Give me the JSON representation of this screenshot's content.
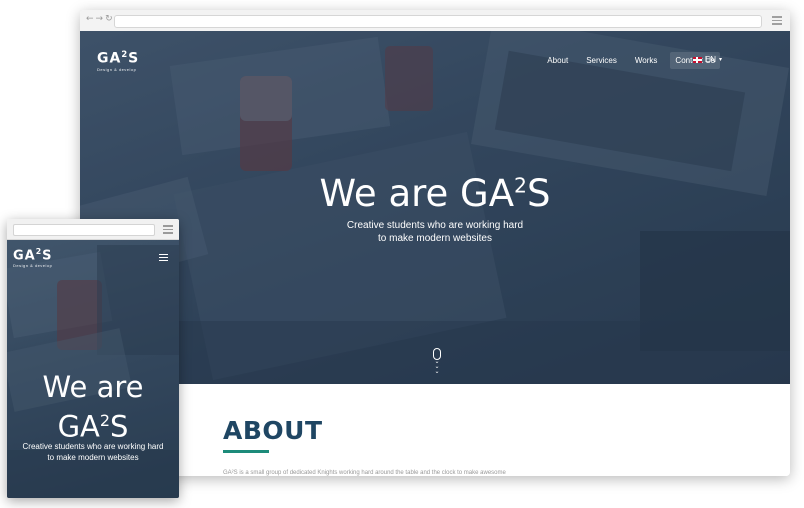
{
  "desktop": {
    "brand": {
      "name": "GA",
      "sup": "2",
      "suffix": "S",
      "tagline": "Design & develop"
    },
    "nav": [
      {
        "label": "About"
      },
      {
        "label": "Services"
      },
      {
        "label": "Works"
      },
      {
        "label": "Contact Us",
        "active": true
      }
    ],
    "language": {
      "code": "EN",
      "caret": "▾"
    },
    "hero": {
      "title_prefix": "We are GA",
      "title_sup": "2",
      "title_suffix": "S",
      "subtitle_line1": "Creative students who are working hard",
      "subtitle_line2": "to make modern websites"
    },
    "about": {
      "heading": "ABOUT",
      "text": "GA²S is a small group of dedicated Knights working hard around the table and the clock to make awesome"
    }
  },
  "mobile": {
    "brand": {
      "name": "GA",
      "sup": "2",
      "suffix": "S",
      "tagline": "Design & develop"
    },
    "hero": {
      "title_line1": "We are",
      "title_prefix": "GA",
      "title_sup": "2",
      "title_suffix": "S",
      "subtitle_line1": "Creative students who are working hard",
      "subtitle_line2": "to make modern websites"
    }
  },
  "colors": {
    "accent": "#1d8b7a",
    "heading": "#1f4663",
    "hero_overlay": "#2f4358"
  },
  "icons": {
    "browser_nav": "back-forward-reload-icons",
    "browser_menu": "hamburger-icon",
    "scroll": "mouse-scroll-icon",
    "flag": "uk-flag-icon"
  }
}
